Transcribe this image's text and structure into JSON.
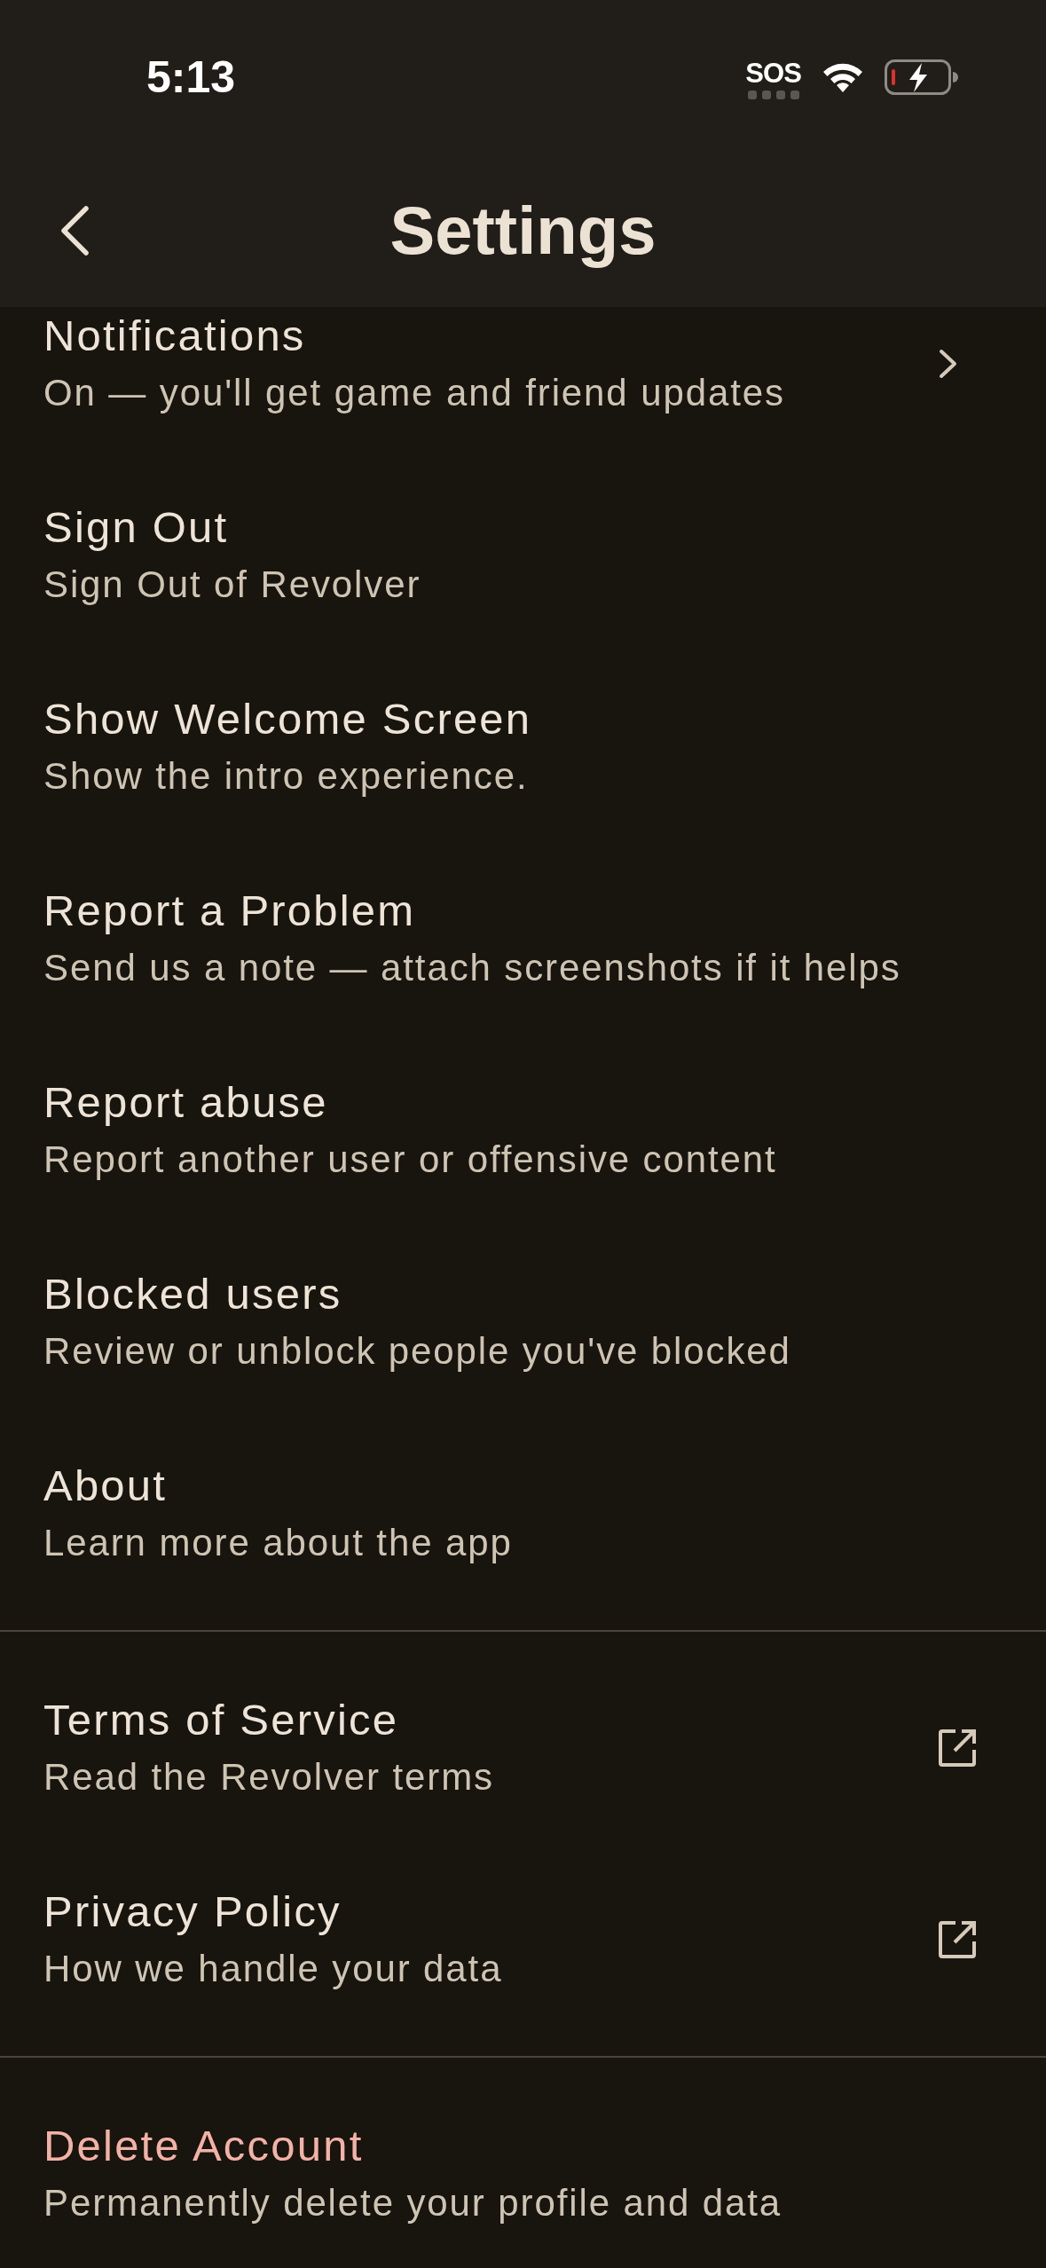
{
  "status_bar": {
    "time": "5:13",
    "network": "SOS"
  },
  "nav_bar": {
    "title": "Settings"
  },
  "sections": [
    {
      "items": [
        {
          "kind": "navigate",
          "title": "Notifications",
          "subtitle": "On — you'll get game and friend updates"
        },
        {
          "kind": "plain",
          "title": "Sign Out",
          "subtitle": "Sign Out of Revolver"
        },
        {
          "kind": "plain",
          "title": "Show Welcome Screen",
          "subtitle": "Show the intro experience."
        },
        {
          "kind": "plain",
          "title": "Report a Problem",
          "subtitle": "Send us a note — attach screenshots if it helps"
        },
        {
          "kind": "plain",
          "title": "Report abuse",
          "subtitle": "Report another user or offensive content"
        },
        {
          "kind": "plain",
          "title": "Blocked users",
          "subtitle": "Review or unblock people you've blocked"
        },
        {
          "kind": "plain",
          "title": "About",
          "subtitle": "Learn more about the app"
        }
      ]
    },
    {
      "items": [
        {
          "kind": "external",
          "title": "Terms of Service",
          "subtitle": "Read the Revolver terms"
        },
        {
          "kind": "external",
          "title": "Privacy Policy",
          "subtitle": "How we handle your data"
        }
      ]
    },
    {
      "items": [
        {
          "kind": "destructive",
          "title": "Delete Account",
          "subtitle": "Permanently delete your profile and data"
        }
      ]
    }
  ]
}
